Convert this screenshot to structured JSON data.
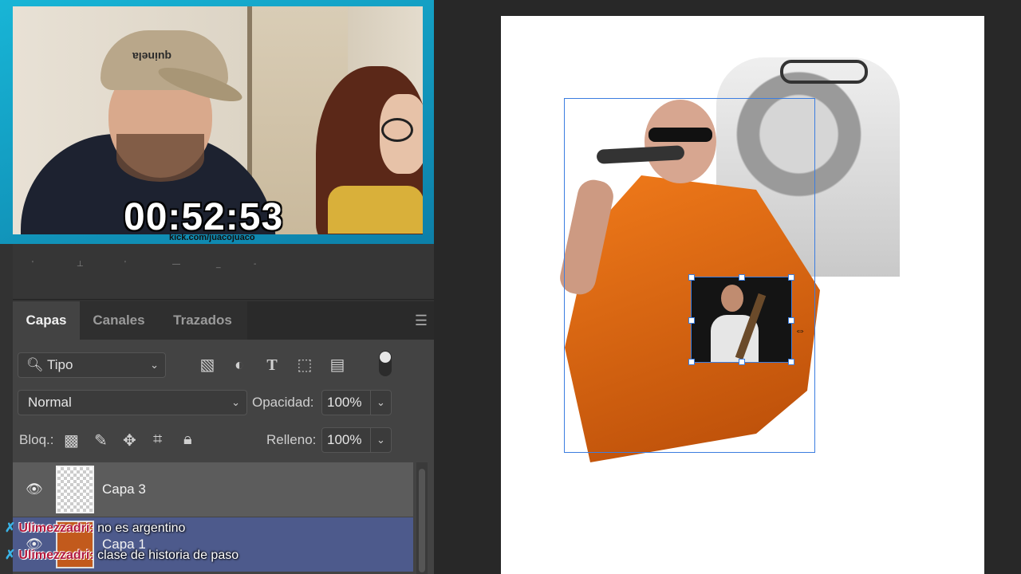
{
  "webcam": {
    "timer": "00:52:53",
    "kick_url": "kick.com/juacojuaco",
    "cap_text": "quinela"
  },
  "panel": {
    "tabs": [
      {
        "label": "Capas",
        "active": true
      },
      {
        "label": "Canales",
        "active": false
      },
      {
        "label": "Trazados",
        "active": false
      }
    ],
    "filter": {
      "label": "Tipo"
    },
    "blend_mode": "Normal",
    "opacity_label": "Opacidad:",
    "opacity_value": "100%",
    "lock_label": "Bloq.:",
    "fill_label": "Relleno:",
    "fill_value": "100%",
    "layers": [
      {
        "name": "Capa 3",
        "visible": true,
        "selected": false
      },
      {
        "name": "Capa 1",
        "visible": true,
        "selected": true
      }
    ]
  },
  "chat": [
    {
      "user": "Ulimezzadri:",
      "message": "no es argentino"
    },
    {
      "user": "Ulimezzadri:",
      "message": "clase de historia de paso"
    }
  ],
  "icons": {
    "search": "search-icon",
    "image": "image-filter-icon",
    "adjust": "adjustment-filter-icon",
    "type": "type-filter-icon",
    "shape": "shape-filter-icon",
    "smart": "smart-object-filter-icon"
  },
  "colors": {
    "accent": "#3b7de0",
    "selected_layer": "#4d5a8c",
    "webcam_border": "#18b5d6",
    "chat_user": "#b2173c"
  }
}
